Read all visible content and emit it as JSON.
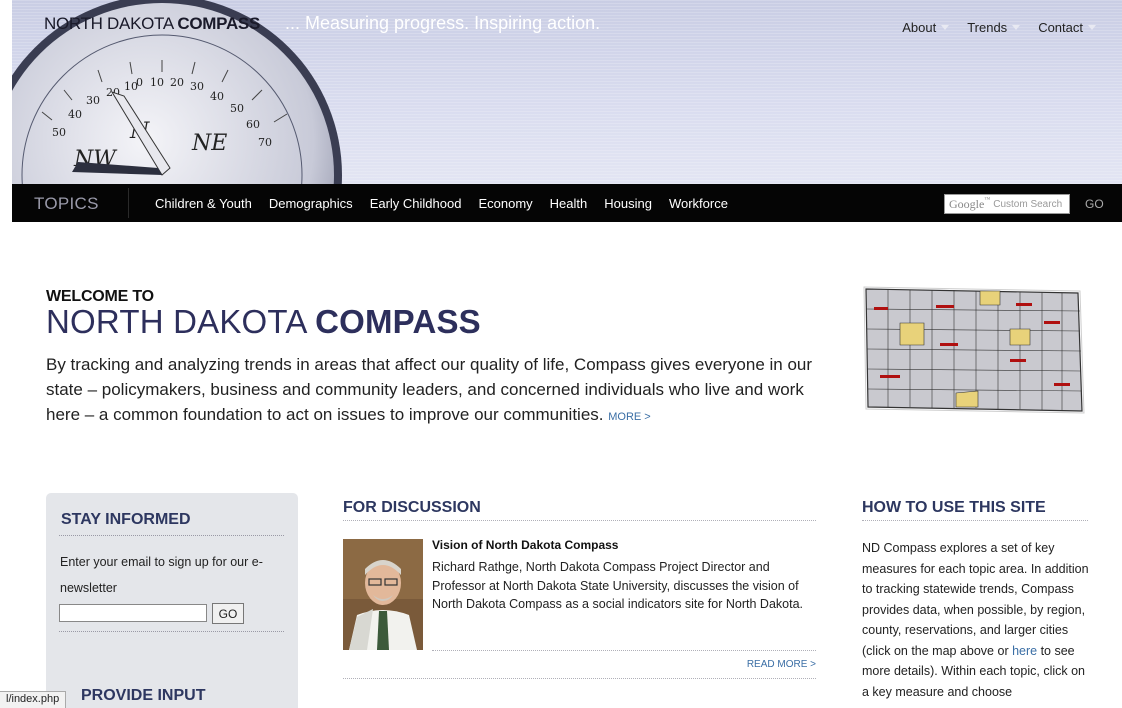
{
  "header": {
    "brand_light": "NORTH DAKOTA",
    "brand_bold": "COMPASS",
    "tagline": "... Measuring progress. Inspiring action.",
    "nav": [
      {
        "label": "About"
      },
      {
        "label": "Trends"
      },
      {
        "label": "Contact"
      }
    ],
    "compass_numbers": [
      "0",
      "10",
      "20",
      "30",
      "40",
      "50",
      "60",
      "70",
      "10",
      "20",
      "30",
      "40",
      "50"
    ],
    "compass_letters": [
      "N",
      "NE",
      "NW"
    ]
  },
  "topics": {
    "label": "TOPICS",
    "items": [
      "Children & Youth",
      "Demographics",
      "Early Childhood",
      "Economy",
      "Health",
      "Housing",
      "Workforce"
    ],
    "search_brand": "Google",
    "search_tm": "™",
    "search_placeholder": "Custom Search",
    "search_go": "GO"
  },
  "welcome": {
    "kicker": "WELCOME TO",
    "title_light": "NORTH DAKOTA ",
    "title_bold": "COMPASS",
    "body": "By tracking and analyzing trends in areas that affect our quality of life, Compass gives everyone in our state – policymakers, business and community leaders, and concerned individuals who live and work here – a common foundation to act on issues to improve our communities.",
    "more": "MORE >"
  },
  "stay": {
    "title": "STAY INFORMED",
    "text": "Enter your email to sign up for our e-newsletter",
    "email_value": "",
    "go": "GO",
    "provide_title": "PROVIDE INPUT"
  },
  "discussion": {
    "title": "FOR DISCUSSION",
    "headline": "Vision of North Dakota Compass",
    "body": "Richard Rathge, North Dakota Compass Project Director and Professor at North Dakota State University, discusses the vision of North Dakota Compass as a social indicators site for North Dakota.",
    "read_more": "READ MORE >"
  },
  "howto": {
    "title": "HOW TO USE THIS SITE",
    "body_before": "ND Compass explores a set of key measures for each topic area. In addition to tracking statewide trends, Compass provides data, when possible, by region, county, reservations, and larger cities (click on the map above or ",
    "link": "here",
    "body_after": " to see more details). Within each topic, click on a key measure and choose"
  },
  "status": {
    "url": "l/index.php"
  },
  "colors": {
    "header_bg": "#d3d6ea",
    "topics_bar": "#050505",
    "heading_navy": "#2d3760",
    "link_blue": "#3a6ea5"
  }
}
